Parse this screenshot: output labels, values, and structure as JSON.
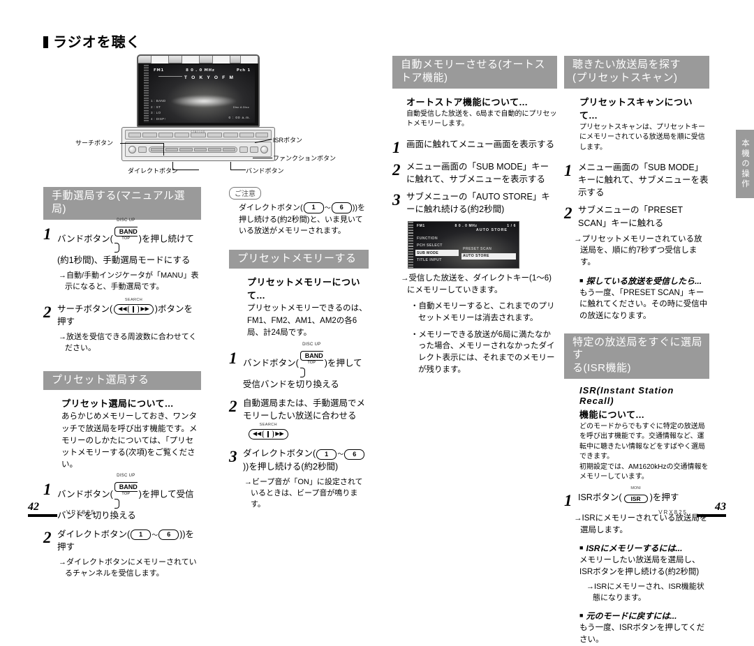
{
  "spread": {
    "main_title": "ラジオを聴く",
    "side_tab": "本機の操作",
    "left_folio": "42",
    "right_folio": "43",
    "model": "VRX825"
  },
  "device_illustration": {
    "lcd": {
      "band": "FM1",
      "frequency": "8 0 . 0 MHz",
      "preset": "Pch 1",
      "station": "T O K Y O   F M",
      "menu_lines": [
        "1 : BAND",
        "2 : ST",
        "3 : LO",
        "4 : DISP↑"
      ],
      "disc_label": "Disc A Disc",
      "clock": "0 : 00 a.m."
    },
    "callouts": [
      {
        "name": "search-button",
        "label": "サーチボタン"
      },
      {
        "name": "direct-button",
        "label": "ダイレクトボタン"
      },
      {
        "name": "band-button",
        "label": "バンドボタン"
      },
      {
        "name": "isr-button",
        "label": "ISRボタン"
      },
      {
        "name": "function-button",
        "label": "ファンクションボタン"
      }
    ],
    "faceplate_brand": "clarion"
  },
  "buttons": {
    "band": {
      "cap": "DISC UP",
      "main": "BAND",
      "sub": "TOP"
    },
    "search": {
      "cap": "SEARCH",
      "left": "◀◀",
      "right": "▶▶"
    },
    "direct_1": "1",
    "direct_6": "6",
    "isr": {
      "cap": "MONI",
      "main": "ISR"
    },
    "separator": "～"
  },
  "sections": {
    "manual_tuning": {
      "heading": "手動選局する(マニュアル選局)",
      "steps": [
        {
          "num": "1",
          "text_before": "バンドボタン(",
          "text_after": ")を押し続けて(約1秒間)、手動選局モードにする",
          "note": "→自動/手動インジケータが「MANU」表示になると、手動選局です。"
        },
        {
          "num": "2",
          "text_before": "サーチボタン(",
          "text_after": ")ボタンを押す",
          "note": "→放送を受信できる周波数に合わせてください。"
        }
      ]
    },
    "preset_tuning": {
      "heading": "プリセット選局する",
      "about_title": "プリセット選局について...",
      "about_body": "あらかじめメモリーしておき、ワンタッチで放送局を呼び出す機能です。メモリーのしかたについては、「プリセットメモリーする(次項)をご覧ください。",
      "steps": [
        {
          "num": "1",
          "text_before": "バンドボタン(",
          "text_after": ")を押して受信バンドを切り換える"
        },
        {
          "num": "2",
          "text_before": "ダイレクトボタン(",
          "text_after": ")を押す",
          "note": "→ダイレクトボタンにメモリーされているチャンネルを受信します。"
        }
      ]
    },
    "caution": {
      "tag": "ご注意",
      "text_before": "ダイレクトボタン(",
      "text_after": ")を押し続ける(約2秒間)と、いま見いている放送がメモリーされます。"
    },
    "preset_memory": {
      "heading": "プリセットメモリーする",
      "about_title": "プリセットメモリーについて...",
      "about_body": "プリセットメモリーできるのは、FM1、FM2、AM1、AM2の各6局、計24局です。",
      "steps": [
        {
          "num": "1",
          "text_before": "バンドボタン(",
          "text_after": ")を押して受信バンドを切り換える"
        },
        {
          "num": "2",
          "text_before": "自動選局または、手動選局でメモリーしたい放送に合わせる",
          "text_after": ""
        },
        {
          "num": "3",
          "text_before": "ダイレクトボタン(",
          "text_after": ")を押し続ける(約2秒間)",
          "note": "→ビープ音が「ON」に設定されているときは、ビープ音が鳴ります。"
        }
      ]
    },
    "auto_store": {
      "heading": "自動メモリーさせる(オートストア機能)",
      "about_title": "オートストア機能について...",
      "about_body": "自動受信した放送を、6局まで自動的にプリセットメモリーします。",
      "steps": [
        {
          "num": "1",
          "text": "画面に触れてメニュー画面を表示する"
        },
        {
          "num": "2",
          "text": "メニュー画面の「SUB MODE」キーに触れて、サブメニューを表示する"
        },
        {
          "num": "3",
          "text": "サブメニューの「AUTO STORE」キーに触れ続ける(約2秒間)"
        }
      ],
      "lcd": {
        "band": "FM1",
        "frequency": "8 0 . 0 MHz",
        "preset": "1 / 6",
        "mode_label": "AUTO STORE",
        "left_items": [
          "FUNCTION",
          "PCH SELECT",
          "SUB MODE",
          "TITLE INPUT"
        ],
        "right_items": [
          "PRESET SCAN",
          "AUTO STORE"
        ]
      },
      "note": "→受信した放送を、ダイレクトキー(1～6)にメモリーしていきます。",
      "bullets": [
        "・自動メモリーすると、これまでのプリセットメモリーは消去されます。",
        "・メモリーできる放送が6局に満たなかった場合、メモリーされなかったダイレクト表示には、それまでのメモリーが残ります。"
      ]
    },
    "preset_scan": {
      "heading_line1": "聴きたい放送局を探す",
      "heading_line2": "(プリセットスキャン)",
      "about_title": "プリセットスキャンについて...",
      "about_body": "プリセットスキャンは、プリセットキーにメモリーされている放送局を順に受信します。",
      "steps": [
        {
          "num": "1",
          "text": "メニュー画面の「SUB MODE」キーに触れて、サブメニューを表示する"
        },
        {
          "num": "2",
          "text": "サブメニューの「PRESET SCAN」キーに触れる"
        }
      ],
      "note": "→プリセットメモリーされている放送局を、順に約7秒ずつ受信します。",
      "sub_title": "探している放送を受信したら...",
      "sub_body": "もう一度、「PRESET SCAN」キーに触れてください。その時に受信中の放送になります。"
    },
    "isr": {
      "heading_line1": "特定の放送局をすぐに選局す",
      "heading_line2": "る(ISR機能)",
      "about_title_1": "ISR(Instant Station Recall)",
      "about_title_2": "機能について...",
      "about_body_1": "どのモードからでもすぐに特定の放送局を呼び出す機能です。交通情報など、運転中に聴きたい情報などをすばやく選局できます。",
      "about_body_2": "初期設定では、AM1620kHzの交通情報をメモリーしています。",
      "step": {
        "num": "1",
        "text_before": "ISRボタン(",
        "text_after": ")を押す"
      },
      "note": "→ISRにメモリーされている放送局を選局します。",
      "sub1_title": "ISRにメモリーするには...",
      "sub1_body": "メモリーしたい放送局を選局し、ISRボタンを押し続ける(約2秒間)",
      "sub1_note": "→ISRにメモリーされ、ISR機能状態になります。",
      "sub2_title": "元のモードに戻すには...",
      "sub2_body": "もう一度、ISRボタンを押してください。"
    }
  },
  "colors": {
    "heading_bg": "#9a9a9a",
    "heading_fg": "#ffffff",
    "text": "#000000"
  }
}
